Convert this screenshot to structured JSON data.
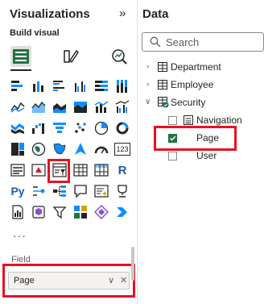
{
  "visualizations": {
    "title": "Visualizations",
    "build_visual_label": "Build visual",
    "more_label": "···",
    "visual_icons": [
      "stacked-bar-chart-icon",
      "stacked-column-chart-icon",
      "clustered-bar-chart-icon",
      "clustered-column-chart-icon",
      "100-stacked-bar-chart-icon",
      "100-stacked-column-chart-icon",
      "line-chart-icon",
      "area-chart-icon",
      "stacked-area-chart-icon",
      "100-stacked-area-chart-icon",
      "line-and-stacked-column-chart-icon",
      "line-and-clustered-column-chart-icon",
      "ribbon-chart-icon",
      "waterfall-chart-icon",
      "funnel-chart-icon",
      "scatter-chart-icon",
      "pie-chart-icon",
      "donut-chart-icon",
      "treemap-icon",
      "map-icon",
      "filled-map-icon",
      "azure-map-icon",
      "gauge-icon",
      "card-icon",
      "multi-row-card-icon",
      "kpi-icon",
      "slicer-icon",
      "table-icon",
      "matrix-icon",
      "r-visual-icon",
      "python-visual-icon",
      "key-influencers-icon",
      "decomposition-tree-icon",
      "qa-icon",
      "smart-narrative-icon",
      "goals-icon",
      "paginated-report-icon",
      "power-apps-icon",
      "power-automate-icon",
      "metrics-icon",
      "more-visuals-icon",
      "arrow-icon"
    ],
    "card_text": "123",
    "r_text": "R",
    "py_text": "Py",
    "field_label": "Field",
    "field_value": "Page"
  },
  "data": {
    "title": "Data",
    "search_placeholder": "Search",
    "tables": [
      {
        "name": "Department",
        "expanded": false
      },
      {
        "name": "Employee",
        "expanded": false
      },
      {
        "name": "Security",
        "expanded": true
      }
    ],
    "security_fields": [
      {
        "name": "Navigation",
        "checked": false
      },
      {
        "name": "Page",
        "checked": true
      },
      {
        "name": "User",
        "checked": false
      }
    ]
  },
  "colors": {
    "accent_green": "#217346",
    "highlight_red": "#e81123"
  }
}
